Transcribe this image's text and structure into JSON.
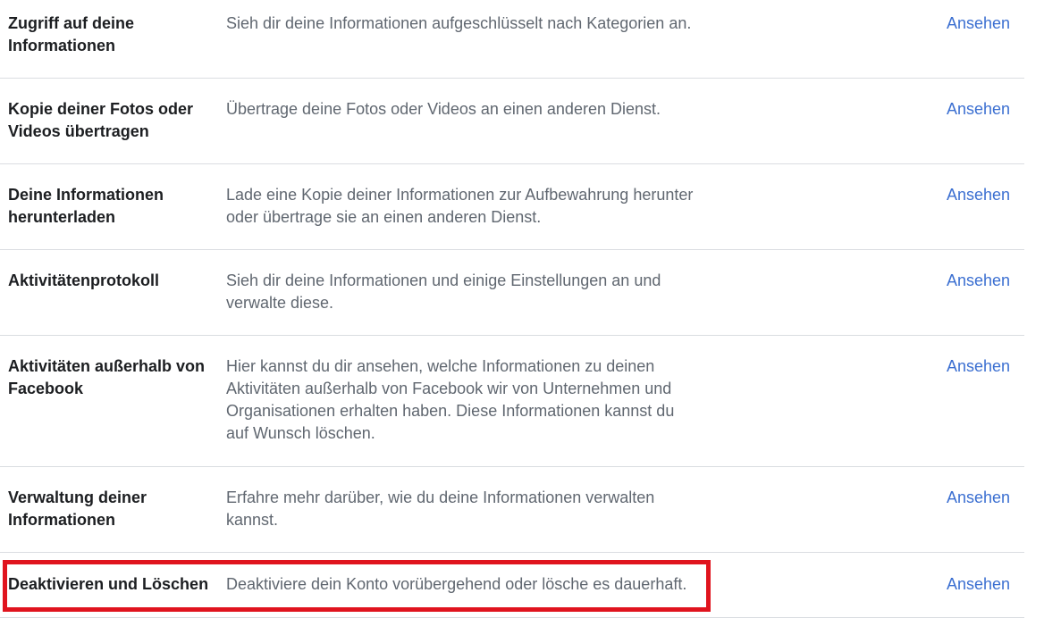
{
  "settings": {
    "rows": [
      {
        "title": "Zugriff auf deine Informationen",
        "description": "Sieh dir deine Informationen aufgeschlüsselt nach Kategorien an.",
        "link": "Ansehen"
      },
      {
        "title": "Kopie deiner Fotos oder Videos übertragen",
        "description": "Übertrage deine Fotos oder Videos an einen anderen Dienst.",
        "link": "Ansehen"
      },
      {
        "title": "Deine Informationen herunterladen",
        "description": "Lade eine Kopie deiner Informationen zur Aufbewahrung herunter oder übertrage sie an einen anderen Dienst.",
        "link": "Ansehen"
      },
      {
        "title": "Aktivitätenprotokoll",
        "description": "Sieh dir deine Informationen und einige Einstellungen an und verwalte diese.",
        "link": "Ansehen"
      },
      {
        "title": "Aktivitäten außerhalb von Facebook",
        "description": "Hier kannst du dir ansehen, welche Informationen zu deinen Aktivitäten außerhalb von Facebook wir von Unternehmen und Organisationen erhalten haben. Diese Informationen kannst du auf Wunsch löschen.",
        "link": "Ansehen"
      },
      {
        "title": "Verwaltung deiner Informationen",
        "description": "Erfahre mehr darüber, wie du deine Informationen verwalten kannst.",
        "link": "Ansehen"
      },
      {
        "title": "Deaktivieren und Löschen",
        "description": "Deaktiviere dein Konto vorübergehend oder lösche es dauerhaft.",
        "link": "Ansehen"
      }
    ]
  },
  "colors": {
    "link": "#3b6fd1",
    "highlight": "#e0141e",
    "divider": "#dadde1"
  }
}
